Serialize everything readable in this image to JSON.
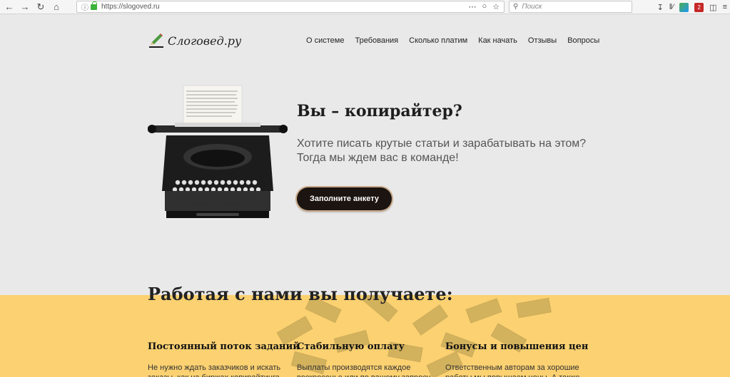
{
  "browser": {
    "url": "https://slogoved.ru",
    "search_placeholder": "Поиск",
    "ext_badge": "2"
  },
  "site": {
    "logo_text": "Слоговед.ру",
    "nav": [
      "О системе",
      "Требования",
      "Сколько платим",
      "Как начать",
      "Отзывы",
      "Вопросы"
    ]
  },
  "hero": {
    "title": "Вы – копирайтер?",
    "subtitle_line1": "Хотите писать крутые статьи и зарабатывать на этом?",
    "subtitle_line2": "Тогда мы ждем вас в команде!",
    "cta": "Заполните анкету"
  },
  "benefits": {
    "title": "Работая с нами вы получаете:",
    "columns": [
      {
        "title": "Постоянный поток заданий",
        "text": "Не нужно ждать заказчиков и искать заказы, как на биржах копирайтинга, в"
      },
      {
        "title": "Стабильную оплату",
        "text": "Выплаты производятся каждое воскресенье или по вашему запросу"
      },
      {
        "title": "Бонусы и повышения цен",
        "text": "Ответственным авторам за хорошие работы мы повышаем цены. А также"
      }
    ]
  },
  "colors": {
    "accent_dark": "#1b1411",
    "benefits_bg": "#fbd171",
    "hero_bg": "#e9e9e9"
  }
}
